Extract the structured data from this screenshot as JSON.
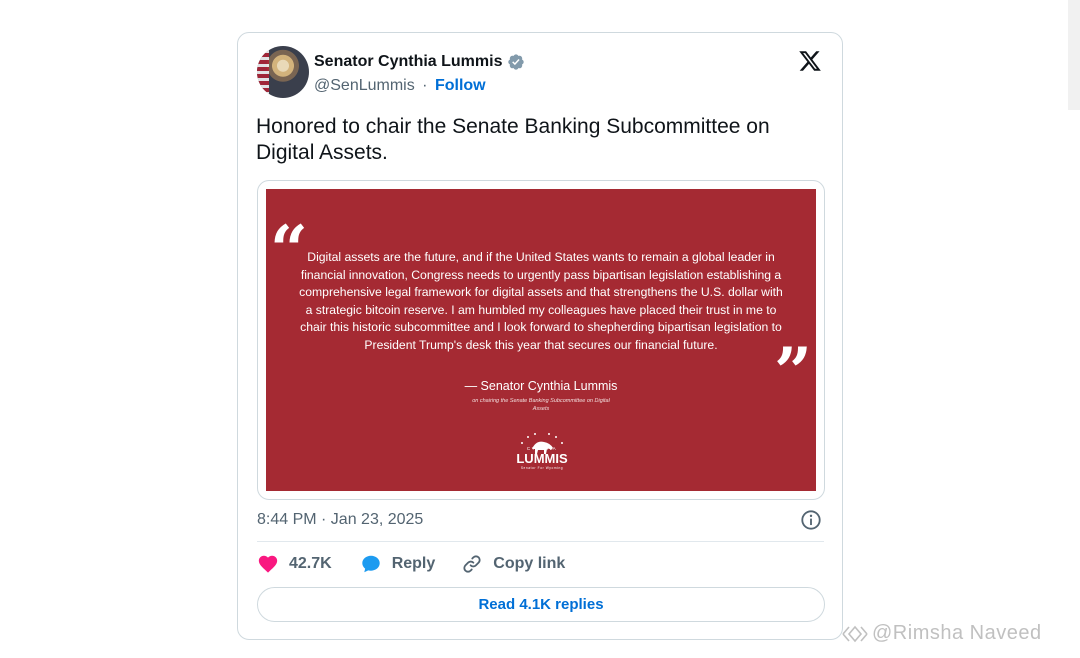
{
  "tweet": {
    "author": {
      "display_name": "Senator Cynthia Lummis",
      "handle": "@SenLummis",
      "separator": "·",
      "follow_label": "Follow",
      "verified_icon": "verified-badge-icon"
    },
    "text": "Honored to chair the Senate Banking Subcommittee on Digital Assets.",
    "media": {
      "quote": "Digital assets are the future, and if the United States wants to remain a global leader in financial innovation, Congress needs to urgently pass bipartisan legislation establishing a comprehensive legal framework for digital assets and that strengthens the U.S. dollar with a strategic bitcoin reserve. I am humbled my colleagues have placed their trust in me to chair this historic subcommittee and I look forward to shepherding bipartisan legislation to President Trump's desk this year that secures our financial future.",
      "attribution": "— Senator Cynthia Lummis",
      "attribution_sub": "on chairing the Senate Banking Subcommittee on Digital Assets",
      "logo_top": "CYNTHIA",
      "logo_name": "LUMMIS",
      "logo_sub": "Senator For Wyoming",
      "background": "#a52a33"
    },
    "timestamp": "8:44 PM · Jan 23, 2025",
    "actions": {
      "likes": "42.7K",
      "reply_label": "Reply",
      "copy_label": "Copy link"
    },
    "replies_button": "Read 4.1K replies"
  },
  "watermark": "@Rimsha Naveed",
  "colors": {
    "accent": "#006fd6",
    "like": "#f91880",
    "reply": "#1d9bf0",
    "muted": "#536471"
  }
}
